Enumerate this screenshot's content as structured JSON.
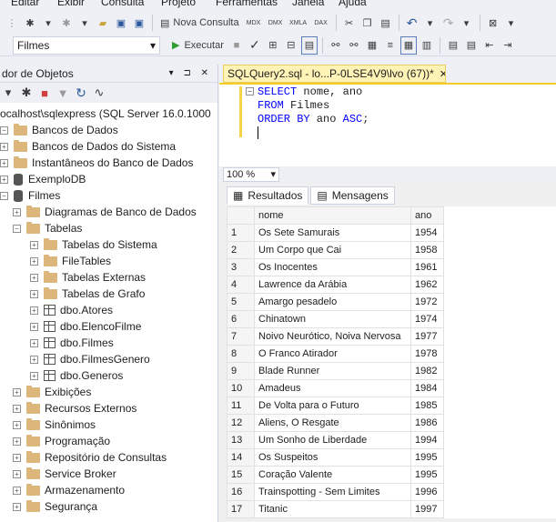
{
  "menu": {
    "items": [
      "Editar",
      "Exibir",
      "Consulta",
      "Projeto",
      "Ferramentas",
      "Janela",
      "Ajuda"
    ]
  },
  "toolbar": {
    "new_query_label": "Nova Consulta",
    "db_selected": "Filmes",
    "execute_label": "Executar",
    "mdx": "MDX",
    "dmx": "DMX",
    "xmla": "XMLA",
    "dax": "DAX"
  },
  "object_explorer": {
    "title": "dor de Objetos",
    "pin": "▾ ⊐ ✕",
    "nodes": [
      {
        "label": "ocalhost\\sqlexpress (SQL Server 16.0.1000",
        "icon": "server-icon",
        "indent": 0
      },
      {
        "label": "Bancos de Dados",
        "icon": "folder-icon",
        "indent": 0
      },
      {
        "label": "Bancos de Dados do Sistema",
        "icon": "folder-icon",
        "indent": 1
      },
      {
        "label": "Instantâneos do Banco de Dados",
        "icon": "folder-icon",
        "indent": 1
      },
      {
        "label": "ExemploDB",
        "icon": "database-icon",
        "indent": 1
      },
      {
        "label": "Filmes",
        "icon": "database-icon",
        "indent": 1
      },
      {
        "label": "Diagramas de Banco de Dados",
        "icon": "folder-icon",
        "indent": 2
      },
      {
        "label": "Tabelas",
        "icon": "folder-icon",
        "indent": 2
      },
      {
        "label": "Tabelas do Sistema",
        "icon": "folder-icon",
        "indent": 3
      },
      {
        "label": "FileTables",
        "icon": "folder-icon",
        "indent": 3
      },
      {
        "label": "Tabelas Externas",
        "icon": "folder-icon",
        "indent": 3
      },
      {
        "label": "Tabelas de Grafo",
        "icon": "folder-icon",
        "indent": 3
      },
      {
        "label": "dbo.Atores",
        "icon": "table-icon",
        "indent": 3
      },
      {
        "label": "dbo.ElencoFilme",
        "icon": "table-icon",
        "indent": 3
      },
      {
        "label": "dbo.Filmes",
        "icon": "table-icon",
        "indent": 3
      },
      {
        "label": "dbo.FilmesGenero",
        "icon": "table-icon",
        "indent": 3
      },
      {
        "label": "dbo.Generos",
        "icon": "table-icon",
        "indent": 3
      },
      {
        "label": "Exibições",
        "icon": "folder-icon",
        "indent": 2
      },
      {
        "label": "Recursos Externos",
        "icon": "folder-icon",
        "indent": 2
      },
      {
        "label": "Sinônimos",
        "icon": "folder-icon",
        "indent": 2
      },
      {
        "label": "Programação",
        "icon": "folder-icon",
        "indent": 2
      },
      {
        "label": "Repositório de Consultas",
        "icon": "folder-icon",
        "indent": 2
      },
      {
        "label": "Service Broker",
        "icon": "folder-icon",
        "indent": 2
      },
      {
        "label": "Armazenamento",
        "icon": "folder-icon",
        "indent": 2
      },
      {
        "label": "Segurança",
        "icon": "folder-icon",
        "indent": 2
      }
    ]
  },
  "editor": {
    "tab_title": "SQLQuery2.sql - lo...P-0LSE4V9\\lvo (67))*",
    "tab_close": "✕",
    "lines": [
      {
        "kw": "SELECT",
        "rest": " nome, ano"
      },
      {
        "kw": "FROM",
        "rest": " Filmes"
      },
      {
        "kw": "ORDER BY",
        "rest": " ano ",
        "kw2": "ASC",
        "tail": ";"
      }
    ],
    "zoom": "100 %"
  },
  "results": {
    "tab_results": "Resultados",
    "tab_messages": "Mensagens",
    "columns": [
      "nome",
      "ano"
    ],
    "rows": [
      [
        "1",
        "Os Sete Samurais",
        "1954"
      ],
      [
        "2",
        "Um Corpo que Cai",
        "1958"
      ],
      [
        "3",
        "Os Inocentes",
        "1961"
      ],
      [
        "4",
        "Lawrence da Arábia",
        "1962"
      ],
      [
        "5",
        "Amargo pesadelo",
        "1972"
      ],
      [
        "6",
        "Chinatown",
        "1974"
      ],
      [
        "7",
        "Noivo Neurótico, Noiva Nervosa",
        "1977"
      ],
      [
        "8",
        "O Franco Atirador",
        "1978"
      ],
      [
        "9",
        "Blade Runner",
        "1982"
      ],
      [
        "10",
        "Amadeus",
        "1984"
      ],
      [
        "11",
        "De Volta para o Futuro",
        "1985"
      ],
      [
        "12",
        "Aliens, O Resgate",
        "1986"
      ],
      [
        "13",
        "Um Sonho de Liberdade",
        "1994"
      ],
      [
        "14",
        "Os Suspeitos",
        "1995"
      ],
      [
        "15",
        "Coração Valente",
        "1995"
      ],
      [
        "16",
        "Trainspotting - Sem Limites",
        "1996"
      ],
      [
        "17",
        "Titanic",
        "1997"
      ]
    ]
  }
}
